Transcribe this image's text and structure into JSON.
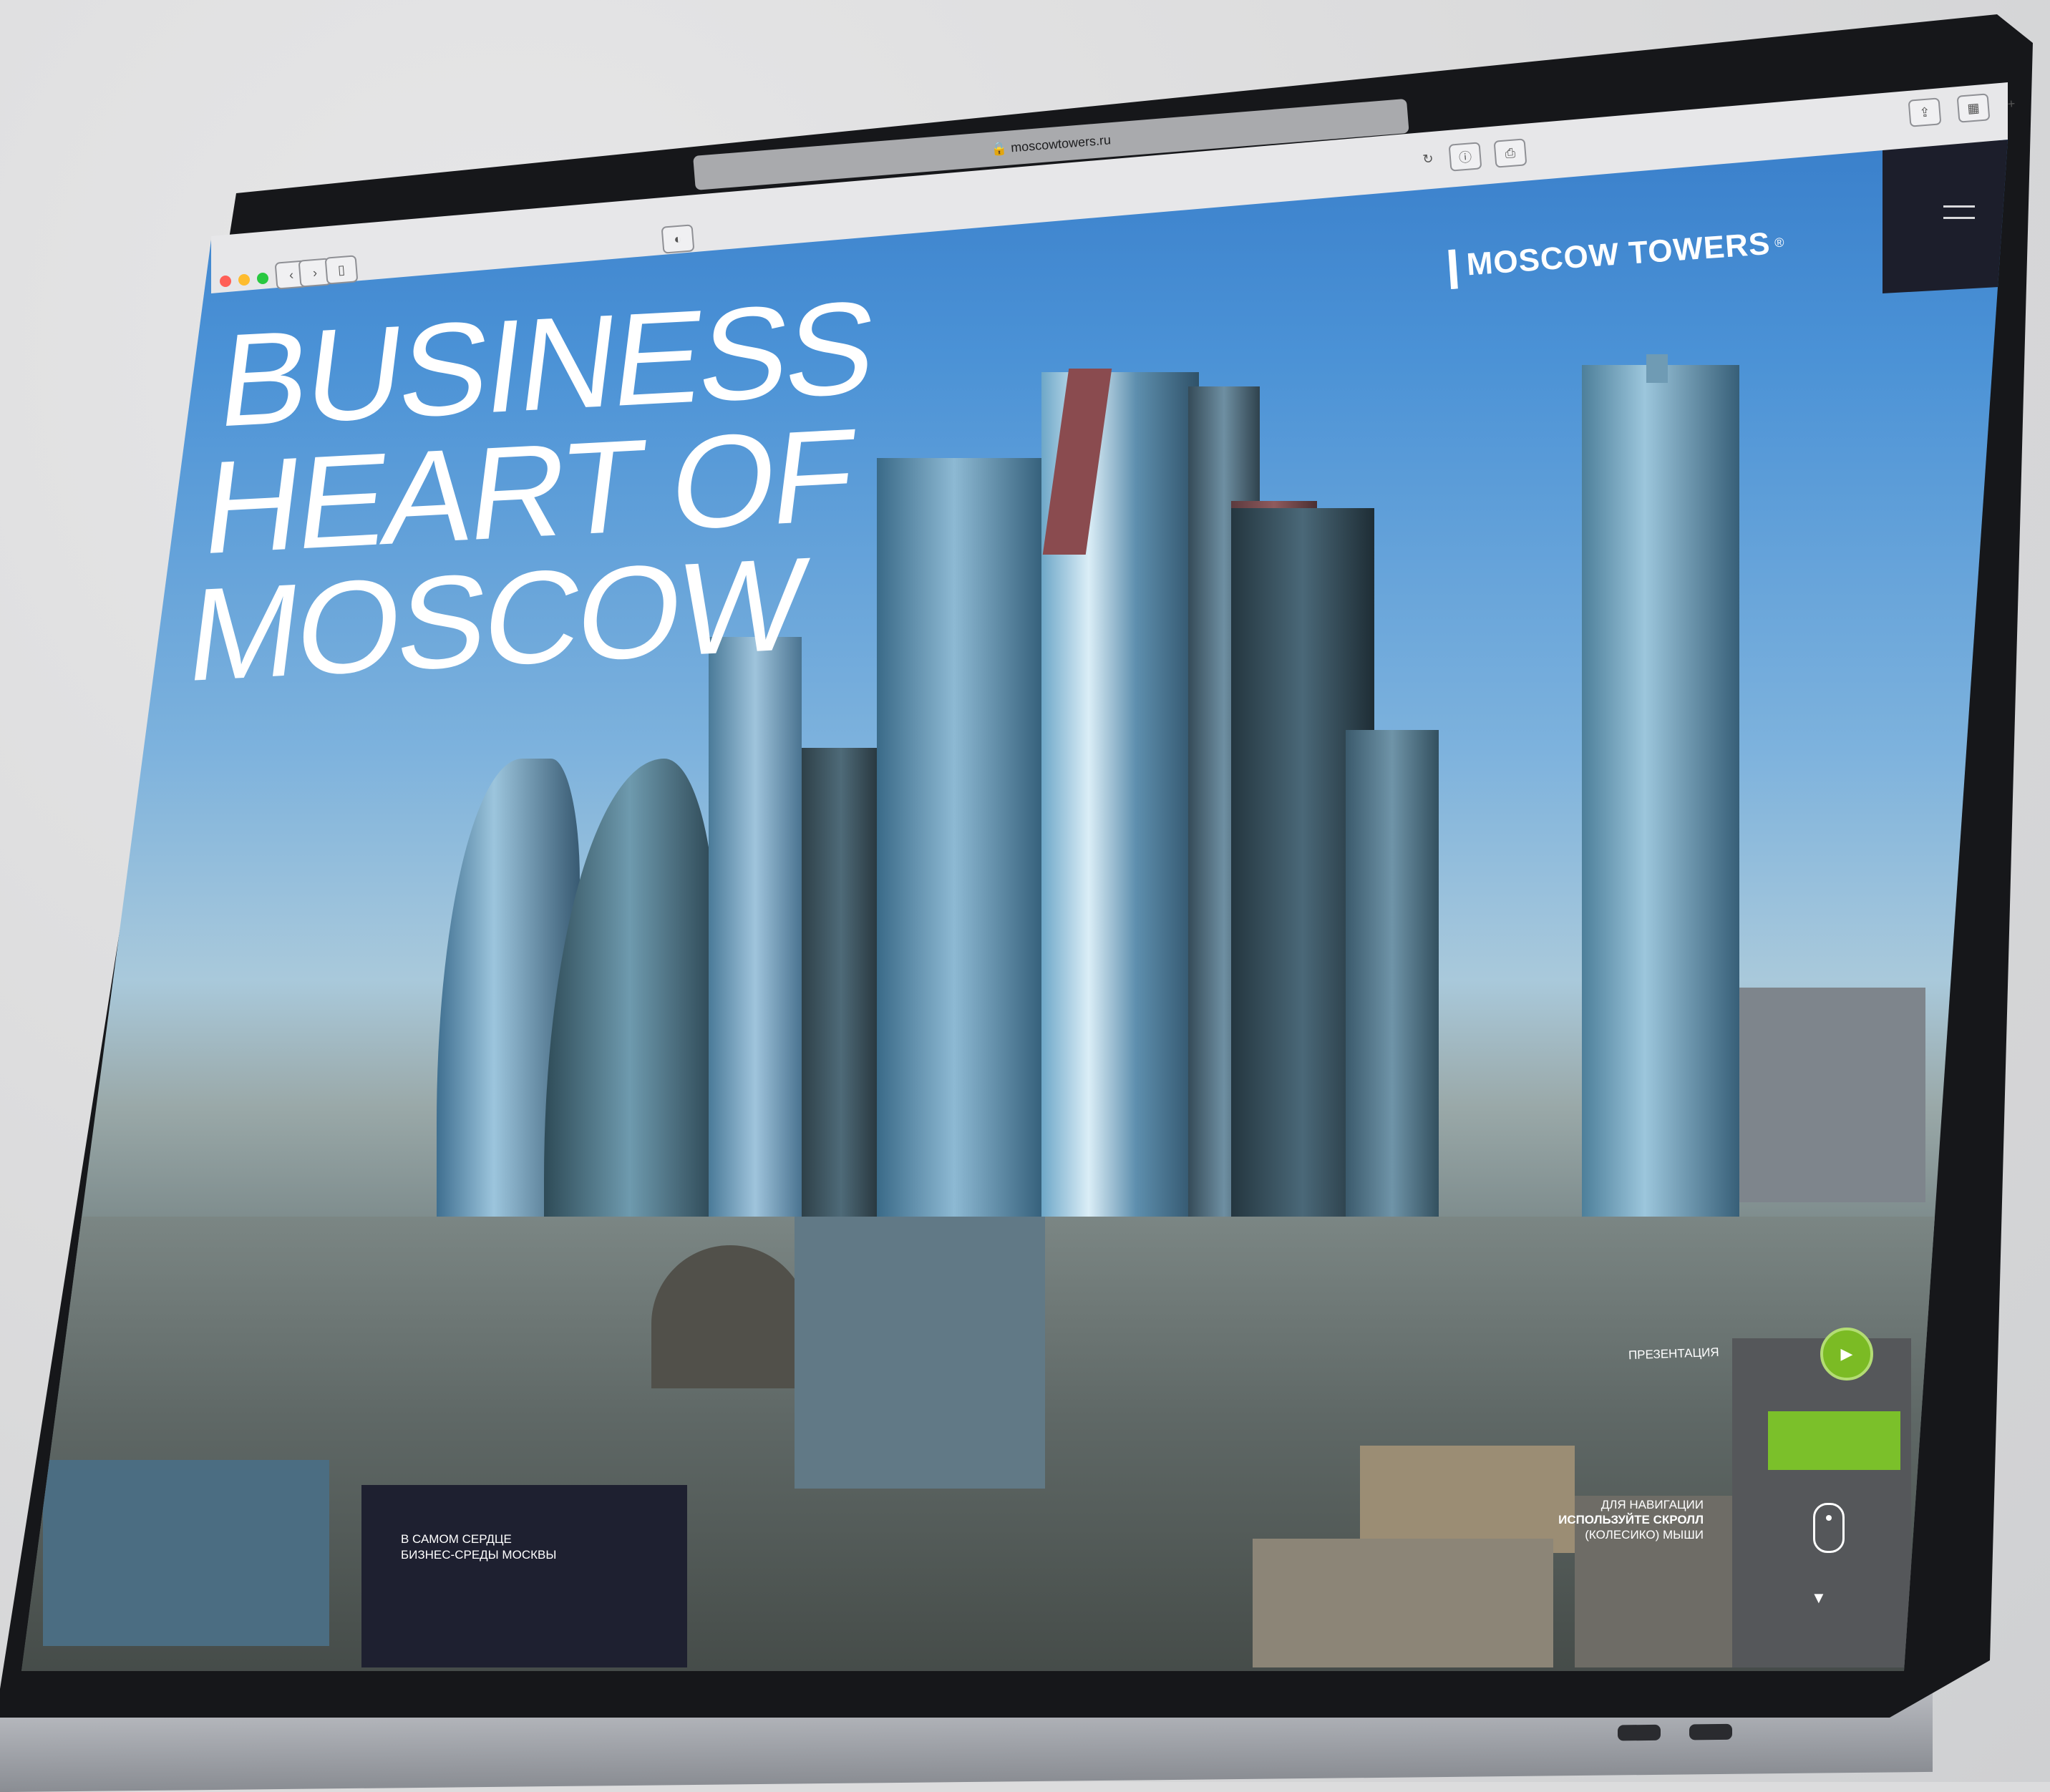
{
  "browser": {
    "url": "moscowtowers.ru",
    "window_controls": {
      "close_color": "#ff5f57",
      "minimize_color": "#febc2e",
      "maximize_color": "#28c840"
    },
    "icons": [
      "back-icon",
      "forward-icon",
      "sidebar-icon",
      "privacy-icon",
      "reload-icon",
      "info-icon",
      "print-icon",
      "share-icon",
      "tabs-icon",
      "new-tab-icon"
    ],
    "new_tab_label": "+"
  },
  "site": {
    "logo": {
      "mark": "||",
      "name": "MOSCOW TOWERS",
      "trademark": "®"
    },
    "hero": {
      "headline_lines": [
        "BUSINESS",
        "HEART OF",
        "MOSCOW"
      ]
    },
    "info_box": {
      "text": "В САМОМ СЕРДЦЕ БИЗНЕС-СРЕДЫ МОСКВЫ"
    },
    "presentation": {
      "label": "ПРЕЗЕНТАЦИЯ",
      "button_glyph": "▶"
    },
    "navigation_hint": {
      "line1": "ДЛЯ НАВИГАЦИИ",
      "line2": "ИСПОЛЬЗУЙТЕ СКРОЛЛ",
      "line3": "(КОЛЕСИКО) МЫШИ"
    },
    "scroll_down_glyph": "▼",
    "colors": {
      "accent_green": "#7bc02a",
      "panel_dark": "#1e2030"
    }
  }
}
